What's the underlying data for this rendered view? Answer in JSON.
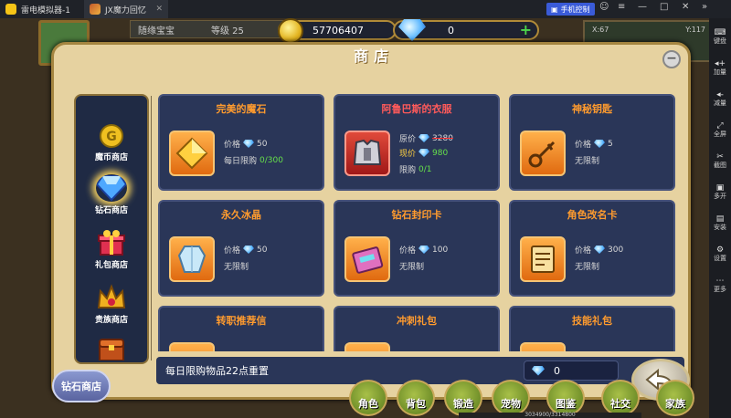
{
  "titlebar": {
    "tabs": [
      {
        "label": "雷电模拟器-1"
      },
      {
        "label": "JX魔力回忆"
      }
    ],
    "phone_control": "手机控制"
  },
  "side_panel": {
    "items": [
      "键盘",
      "加量",
      "减量",
      "全屏",
      "截图",
      "多开",
      "安装",
      "设置",
      "更多"
    ]
  },
  "hud": {
    "pet_name": "随缘宝宝",
    "pet_level": "等级 25",
    "gold": "57706407",
    "gems": "0",
    "map_x": "X:67",
    "map_y": "Y:117",
    "buttons": [
      "角色",
      "背包",
      "锻造",
      "宠物",
      "图鉴",
      "社交",
      "家族"
    ],
    "exp": "3034900/3314800"
  },
  "dialog": {
    "title": "商店",
    "side_nav": [
      {
        "label": "魔币商店"
      },
      {
        "label": "钻石商店"
      },
      {
        "label": "礼包商店"
      },
      {
        "label": "贵族商店"
      }
    ],
    "items": [
      {
        "name": "完美的魔石",
        "price_label": "价格",
        "price": "50",
        "limit_label": "每日限购",
        "limit": "0/300"
      },
      {
        "name": "阿鲁巴斯的衣服",
        "orig_label": "原价",
        "orig_price": "3280",
        "now_label": "现价",
        "now_price": "980",
        "limit_label": "限购",
        "limit": "0/1"
      },
      {
        "name": "神秘钥匙",
        "price_label": "价格",
        "price": "5",
        "limit_label": "无限制"
      },
      {
        "name": "永久冰晶",
        "price_label": "价格",
        "price": "50",
        "limit_label": "无限制"
      },
      {
        "name": "钻石封印卡",
        "price_label": "价格",
        "price": "100",
        "limit_label": "无限制"
      },
      {
        "name": "角色改名卡",
        "price_label": "价格",
        "price": "300",
        "limit_label": "无限制"
      },
      {
        "name": "转职推荐信"
      },
      {
        "name": "冲刺礼包"
      },
      {
        "name": "技能礼包"
      }
    ],
    "reset_note": "每日限购物品22点重置",
    "gem_balance": "0",
    "shop_badge": "钻石商店"
  }
}
